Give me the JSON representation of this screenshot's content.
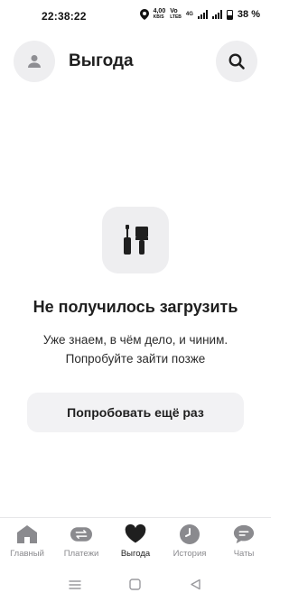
{
  "status": {
    "time": "22:38:22",
    "speed_value": "4,00",
    "speed_unit": "KB/S",
    "volte_top": "Vo",
    "volte_bottom": "LTEB",
    "network": "4G",
    "battery": "38 %"
  },
  "header": {
    "title": "Выгода",
    "avatar_icon": "user-icon",
    "search_icon": "search-icon"
  },
  "error": {
    "icon": "tools-icon",
    "title": "Не получилось загрузить",
    "line1": "Уже знаем, в чём дело, и чиним.",
    "line2": "Попробуйте зайти позже",
    "retry_label": "Попробовать ещё раз"
  },
  "tabs": [
    {
      "label": "Главный",
      "icon": "home-icon",
      "active": false
    },
    {
      "label": "Платежи",
      "icon": "transfer-icon",
      "active": false
    },
    {
      "label": "Выгода",
      "icon": "heart-icon",
      "active": true
    },
    {
      "label": "История",
      "icon": "clock-icon",
      "active": false
    },
    {
      "label": "Чаты",
      "icon": "chat-icon",
      "active": false
    }
  ],
  "colors": {
    "accent": "#1f1f1f",
    "inactive": "#8a8a8e",
    "surface": "#eeeef0"
  }
}
